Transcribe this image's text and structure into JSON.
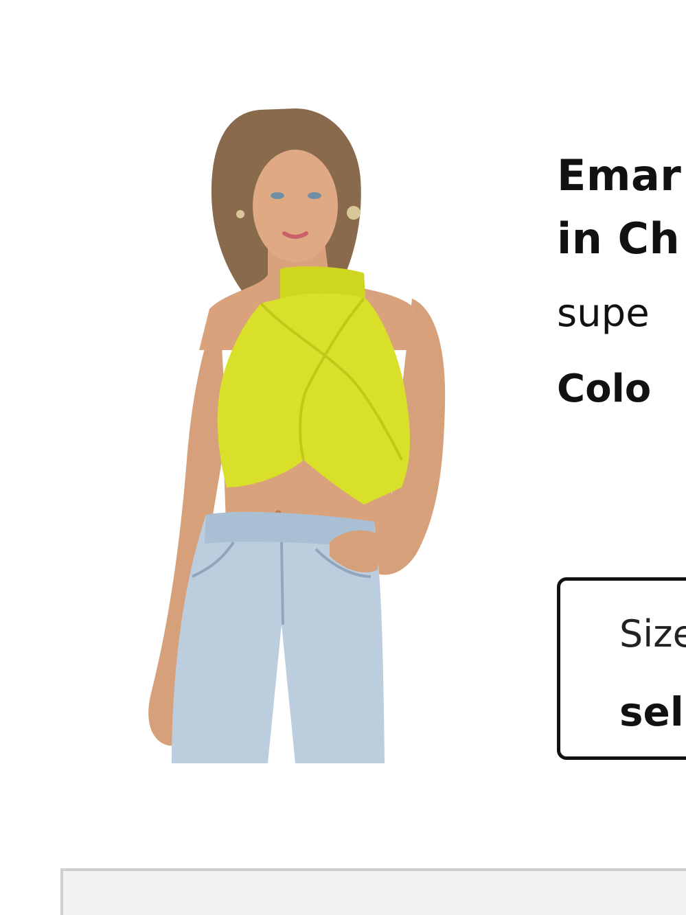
{
  "product": {
    "title_line1": "Emar",
    "title_line2": "in Ch",
    "brand": "supe",
    "color_label": "Colo",
    "image_alt": "Model wearing chartreuse halter wrap crop top with light-wash jeans"
  },
  "size_select": {
    "label": "Size",
    "value": "sel"
  },
  "colors": {
    "top_fabric": "#d9e02a",
    "denim": "#b9cbdd",
    "skin": "#d9a27c",
    "hair": "#8a6a4c"
  }
}
